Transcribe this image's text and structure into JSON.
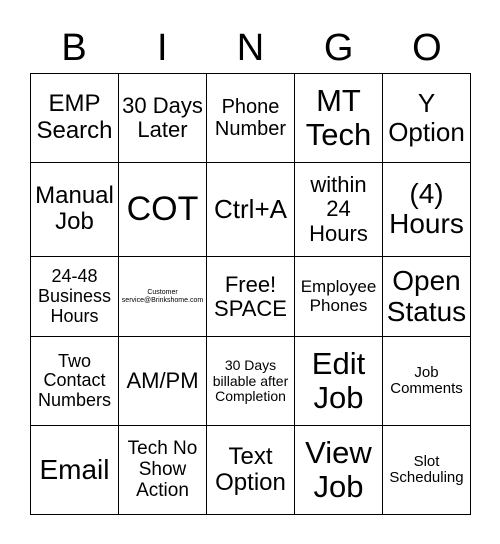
{
  "header": [
    "B",
    "I",
    "N",
    "G",
    "O"
  ],
  "cells": [
    [
      "EMP Search",
      "30 Days Later",
      "Phone Number",
      "MT Tech",
      "Y Option"
    ],
    [
      "Manual Job",
      "COT",
      "Ctrl+A",
      "within 24 Hours",
      "(4) Hours"
    ],
    [
      "24-48 Business Hours",
      "Customer service@Brinkshome.com",
      "Free! SPACE",
      "Employee Phones",
      "Open Status"
    ],
    [
      "Two Contact Numbers",
      "AM/PM",
      "30 Days billable after Completion",
      "Edit Job",
      "Job Comments"
    ],
    [
      "Email",
      "Tech No Show Action",
      "Text Option",
      "View Job",
      "Slot Scheduling"
    ]
  ]
}
